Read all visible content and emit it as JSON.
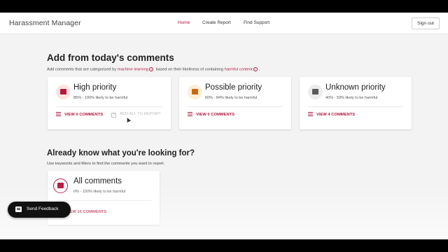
{
  "header": {
    "brand": "Harassment Manager",
    "nav": [
      "Home",
      "Create Report",
      "Find Support"
    ],
    "active_nav": "Home",
    "signout_label": "Sign out"
  },
  "section1": {
    "title": "Add from today's comments",
    "subtitle_part1": "Add comments that are categorized by",
    "subtitle_link1": "machine learning",
    "subtitle_part2": "based on their likeliness of containing",
    "subtitle_link2": "harmful content",
    "subtitle_end": "."
  },
  "cards": [
    {
      "title": "High priority",
      "range": "85% - 100% likely to be harmful",
      "action": "VIEW 0 COMMENTS",
      "secondary_action": "ADD ALL TO REPORT",
      "badge_bg": "#fbe4e4",
      "badge_color": "#b3193f",
      "icon": "flag-list-icon"
    },
    {
      "title": "Possible priority",
      "range": "60% - 84% likely to be harmful",
      "action": "VIEW 0 COMMENTS",
      "badge_bg": "#fdeed8",
      "badge_color": "#c66a10",
      "icon": "warning-comment-icon"
    },
    {
      "title": "Unknown priority",
      "range": "40% - 59% likely to be harmful",
      "action": "VIEW 4 COMMENTS",
      "badge_bg": "#ececec",
      "badge_color": "#5a5a5a",
      "icon": "question-comment-icon"
    }
  ],
  "section2": {
    "title": "Already know what you're looking for?",
    "subtitle": "Use keywords and filters to find the comments you want to report."
  },
  "all_card": {
    "title": "All comments",
    "range": "0% - 100% likely to be harmful",
    "action": "VIEW 16 COMMENTS",
    "badge_bg": "#fff",
    "badge_color": "#b3193f",
    "icon": "search-comments-icon"
  },
  "feedback": {
    "label": "Send Feedback"
  },
  "colors": {
    "accent": "#b3193f",
    "background": "#f3f3f3"
  }
}
